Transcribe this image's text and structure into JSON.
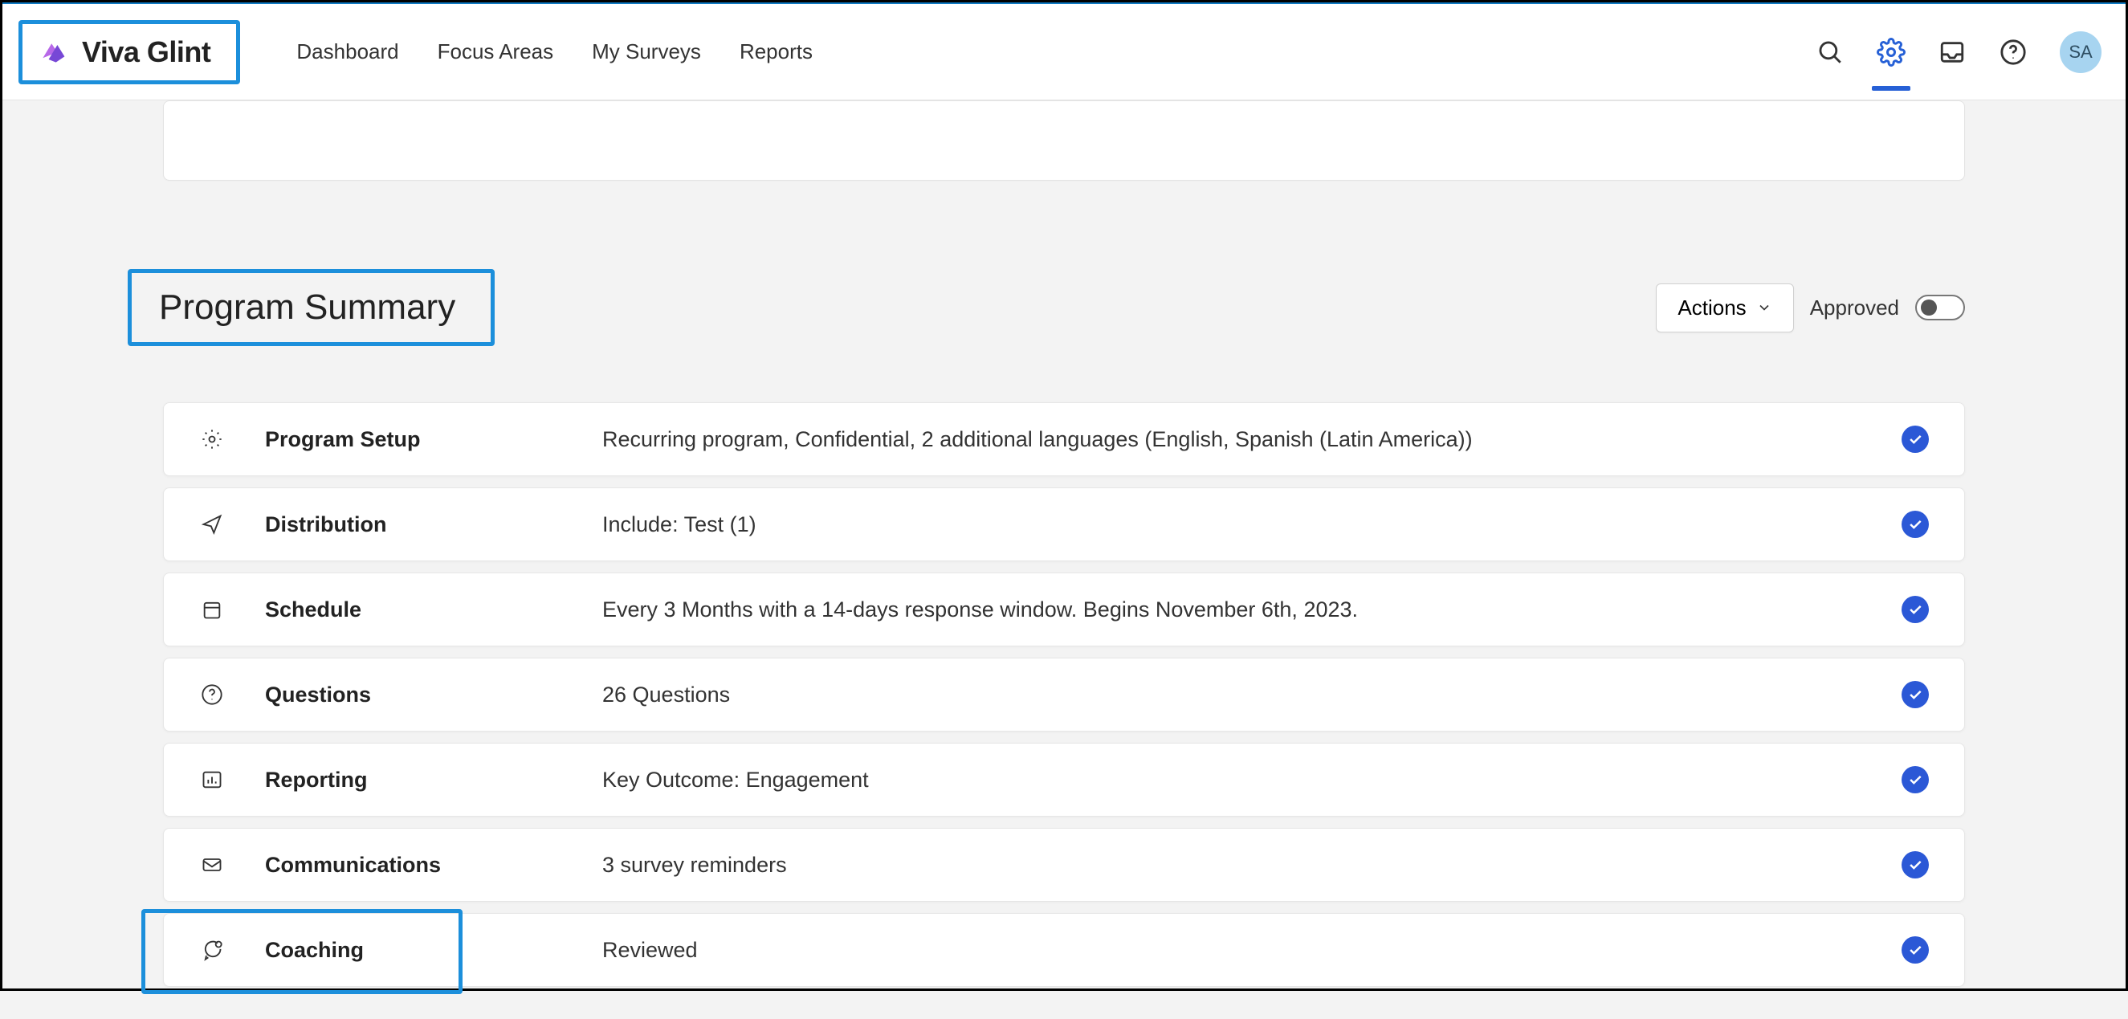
{
  "brand": {
    "name": "Viva Glint"
  },
  "nav": {
    "items": [
      {
        "label": "Dashboard"
      },
      {
        "label": "Focus Areas"
      },
      {
        "label": "My Surveys"
      },
      {
        "label": "Reports"
      }
    ]
  },
  "avatar": {
    "initials": "SA"
  },
  "summary": {
    "title": "Program Summary",
    "actions_label": "Actions",
    "approved_label": "Approved",
    "approved_on": false,
    "rows": [
      {
        "icon": "gear",
        "title": "Program Setup",
        "desc": "Recurring program, Confidential, 2 additional languages (English, Spanish (Latin America))"
      },
      {
        "icon": "send",
        "title": "Distribution",
        "desc": "Include: Test (1)"
      },
      {
        "icon": "calendar",
        "title": "Schedule",
        "desc": "Every 3 Months with a 14-days response window. Begins November 6th, 2023."
      },
      {
        "icon": "question",
        "title": "Questions",
        "desc": "26 Questions"
      },
      {
        "icon": "chart",
        "title": "Reporting",
        "desc": "Key Outcome: Engagement"
      },
      {
        "icon": "mail",
        "title": "Communications",
        "desc": "3 survey reminders"
      },
      {
        "icon": "chat",
        "title": "Coaching",
        "desc": "Reviewed"
      }
    ]
  }
}
